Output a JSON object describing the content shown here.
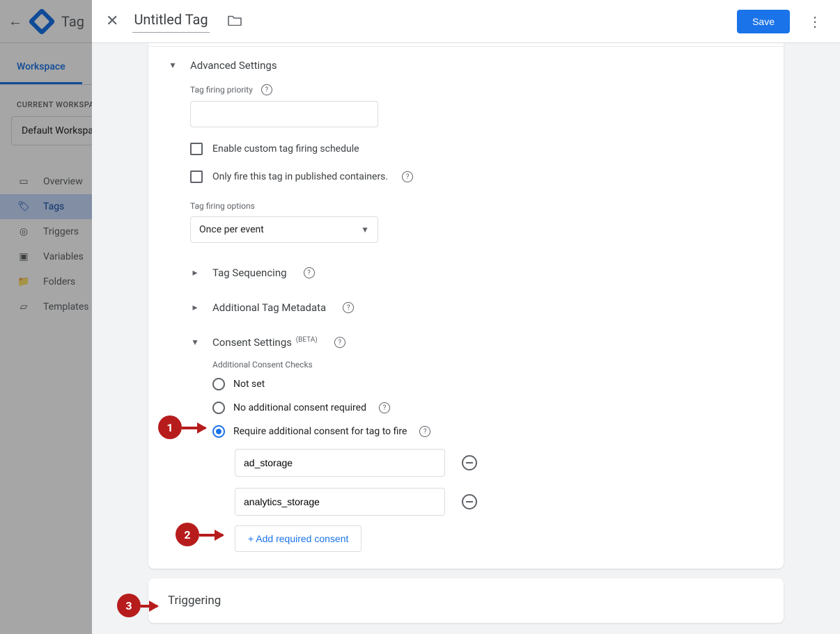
{
  "bg": {
    "app_title": "Tag",
    "workspace_tab": "Workspace",
    "current_ws_label": "CURRENT WORKSPACE",
    "ws_name": "Default Workspace",
    "nav": {
      "overview": "Overview",
      "tags": "Tags",
      "triggers": "Triggers",
      "variables": "Variables",
      "folders": "Folders",
      "templates": "Templates"
    }
  },
  "header": {
    "title": "Untitled Tag",
    "save": "Save"
  },
  "adv": {
    "title": "Advanced Settings",
    "priority_label": "Tag firing priority",
    "chk_schedule": "Enable custom tag firing schedule",
    "chk_published": "Only fire this tag in published containers.",
    "firing_options_label": "Tag firing options",
    "firing_options_value": "Once per event",
    "seq": "Tag Sequencing",
    "meta": "Additional Tag Metadata",
    "consent_title": "Consent Settings",
    "consent_beta": "(BETA)",
    "consent_sub": "Additional Consent Checks",
    "r_notset": "Not set",
    "r_noadd": "No additional consent required",
    "r_require": "Require additional consent for tag to fire",
    "cons1": "ad_storage",
    "cons2": "analytics_storage",
    "add_consent": "+ Add required consent"
  },
  "trig": {
    "title": "Triggering"
  },
  "markers": {
    "m1": "1",
    "m2": "2",
    "m3": "3"
  }
}
